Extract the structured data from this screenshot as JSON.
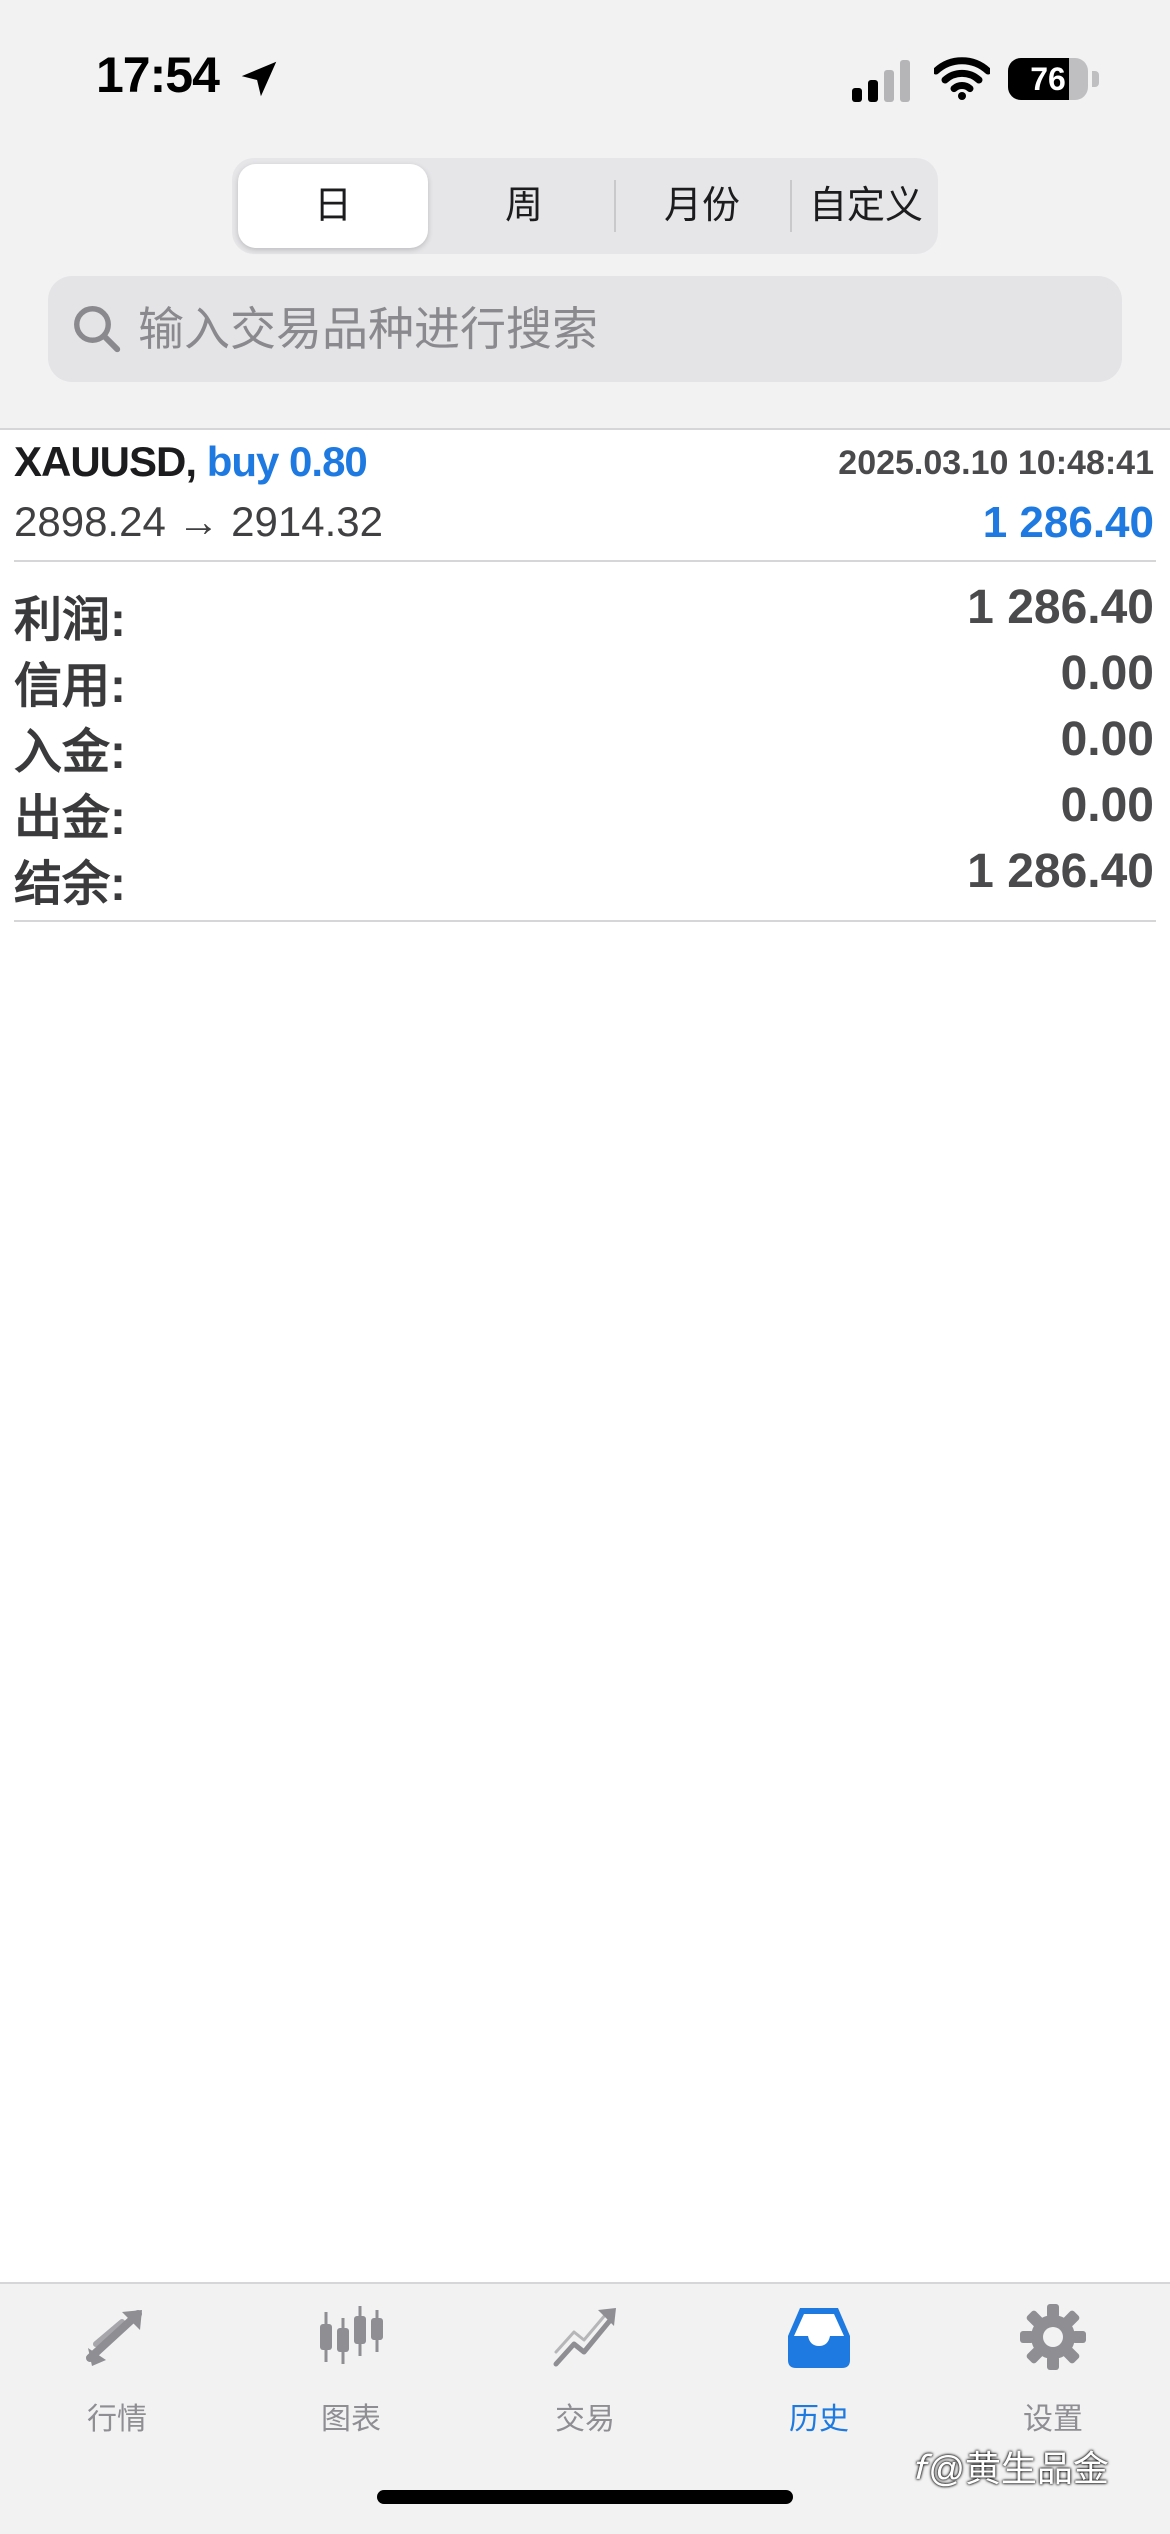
{
  "status_bar": {
    "time": "17:54",
    "battery_level": "76",
    "battery_fraction": 0.76
  },
  "period_tabs": [
    {
      "label": "日",
      "selected": true
    },
    {
      "label": "周",
      "selected": false
    },
    {
      "label": "月份",
      "selected": false
    },
    {
      "label": "自定义",
      "selected": false
    }
  ],
  "search": {
    "placeholder": "输入交易品种进行搜索",
    "value": ""
  },
  "trade": {
    "symbol": "XAUUSD,",
    "side_volume": "buy 0.80",
    "datetime": "2025.03.10 10:48:41",
    "open_price": "2898.24",
    "arrow": "→",
    "close_price": "2914.32",
    "profit": "1 286.40"
  },
  "summary": [
    {
      "label": "利润:",
      "value": "1 286.40"
    },
    {
      "label": "信用:",
      "value": "0.00"
    },
    {
      "label": "入金:",
      "value": "0.00"
    },
    {
      "label": "出金:",
      "value": "0.00"
    },
    {
      "label": "结余:",
      "value": "1 286.40"
    }
  ],
  "tab_bar": [
    {
      "label": "行情",
      "icon": "quotes-arrows-icon",
      "active": false
    },
    {
      "label": "图表",
      "icon": "candlestick-chart-icon",
      "active": false
    },
    {
      "label": "交易",
      "icon": "trade-trend-icon",
      "active": false
    },
    {
      "label": "历史",
      "icon": "history-inbox-icon",
      "active": true
    },
    {
      "label": "设置",
      "icon": "settings-gear-icon",
      "active": false
    }
  ],
  "watermark": {
    "text": "@黄生品金"
  },
  "colors": {
    "accent": "#1e7ae0",
    "inactive": "#8e8e93",
    "background": "#f2f2f3"
  }
}
